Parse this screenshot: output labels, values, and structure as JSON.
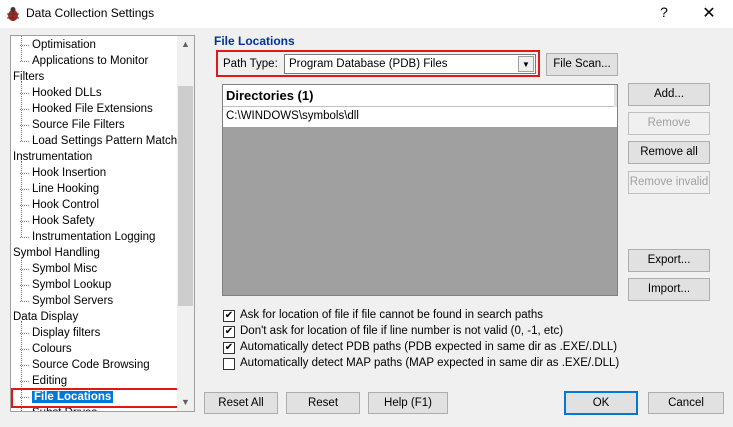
{
  "window": {
    "title": "Data Collection Settings",
    "help": "?",
    "close": "✕"
  },
  "tree": {
    "items": [
      {
        "label": "Optimisation",
        "level": 1
      },
      {
        "label": "Applications to Monitor",
        "level": 1
      },
      {
        "label": "Filters",
        "level": 0
      },
      {
        "label": "Hooked DLLs",
        "level": 1
      },
      {
        "label": "Hooked File Extensions",
        "level": 1
      },
      {
        "label": "Source File Filters",
        "level": 1
      },
      {
        "label": "Load Settings Pattern Match",
        "level": 1
      },
      {
        "label": "Instrumentation",
        "level": 0
      },
      {
        "label": "Hook Insertion",
        "level": 1
      },
      {
        "label": "Line Hooking",
        "level": 1
      },
      {
        "label": "Hook Control",
        "level": 1
      },
      {
        "label": "Hook Safety",
        "level": 1
      },
      {
        "label": "Instrumentation Logging",
        "level": 1
      },
      {
        "label": "Symbol Handling",
        "level": 0
      },
      {
        "label": "Symbol Misc",
        "level": 1
      },
      {
        "label": "Symbol Lookup",
        "level": 1
      },
      {
        "label": "Symbol Servers",
        "level": 1
      },
      {
        "label": "Data Display",
        "level": 0
      },
      {
        "label": "Display filters",
        "level": 1
      },
      {
        "label": "Colours",
        "level": 1
      },
      {
        "label": "Source Code Browsing",
        "level": 1
      },
      {
        "label": "Editing",
        "level": 1
      },
      {
        "label": "File Locations",
        "level": 1,
        "selected": true
      },
      {
        "label": "Subst Drives",
        "level": 1
      }
    ]
  },
  "file_locations": {
    "section_title": "File Locations",
    "path_type_label": "Path Type:",
    "path_type_value": "Program Database (PDB) Files",
    "file_scan": "File Scan...",
    "directories_header": "Directories (1)",
    "directories": [
      "C:\\WINDOWS\\symbols\\dll"
    ],
    "buttons": {
      "add": "Add...",
      "remove": "Remove",
      "remove_all": "Remove all",
      "remove_invalid": "Remove invalid",
      "export": "Export...",
      "import": "Import..."
    },
    "options": [
      {
        "label": "Ask for location of file if file cannot be found in search paths",
        "checked": true
      },
      {
        "label": "Don't ask for location of file if line number is not valid (0, -1, etc)",
        "checked": true
      },
      {
        "label": "Automatically detect PDB paths (PDB expected in same dir as .EXE/.DLL)",
        "checked": true
      },
      {
        "label": "Automatically detect MAP paths (MAP expected in same dir as .EXE/.DLL)",
        "checked": false
      }
    ]
  },
  "footer": {
    "reset_all": "Reset All",
    "reset": "Reset",
    "help": "Help (F1)",
    "ok": "OK",
    "cancel": "Cancel"
  },
  "colors": {
    "accent": "#0078d7",
    "highlight_border": "#e01818",
    "section_title": "#003399"
  }
}
